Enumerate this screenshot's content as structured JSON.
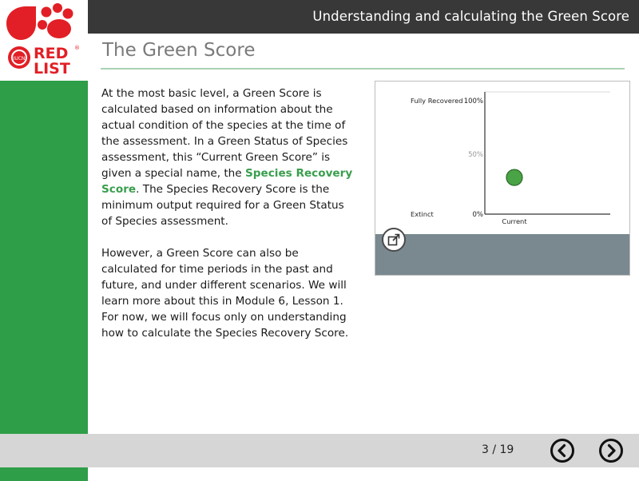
{
  "header": {
    "title": "Understanding and calculating the Green Score"
  },
  "logo": {
    "line1": "RED",
    "line2": "LIST",
    "badge": "IUCN",
    "mark": "®"
  },
  "page": {
    "title": "The Green Score",
    "paragraph1_a": "At the most basic level, a Green Score is calculated based on information about the actual condition of the species at the time of the assessment. In a Green Status of Species assessment, this “Current Green Score” is given a special name, the ",
    "paragraph1_highlight": "Species Recovery Score",
    "paragraph1_b": ". The Species Recovery Score is the minimum output required for a Green Status of Species assessment.",
    "paragraph2": "However, a Green Score can also be calculated for time periods in the past and future, and under different scenarios. We will learn more about this in Module 6, Lesson 1. For now, we will focus only on understanding how to calculate the Species Recovery Score."
  },
  "chart_data": {
    "type": "scatter",
    "y_top_label": "Fully Recovered",
    "y_bottom_label": "Extinct",
    "y_ticks": [
      "100%",
      "50%",
      "0%"
    ],
    "ylim": [
      0,
      100
    ],
    "categories": [
      "Current"
    ],
    "points": [
      {
        "x": "Current",
        "y": 30
      }
    ],
    "point_color": "#4aa345"
  },
  "footer": {
    "page_counter": "3 / 19"
  },
  "colors": {
    "brand_green": "#2e9e48",
    "header_dark": "#383838",
    "logo_red": "#e21f26"
  }
}
